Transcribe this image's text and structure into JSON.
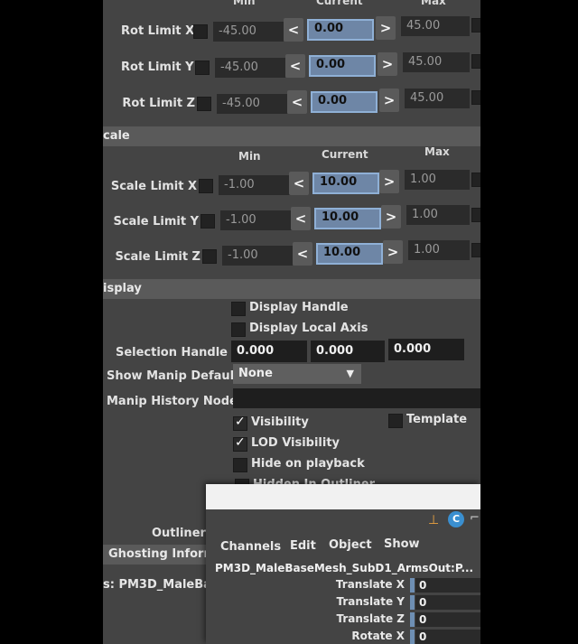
{
  "rot_limits": {
    "headers": {
      "min": "Min",
      "current": "Current",
      "max": "Max"
    },
    "rows": [
      {
        "label": "Rot Limit X",
        "min": "-45.00",
        "current": "0.00",
        "max": "45.00"
      },
      {
        "label": "Rot Limit Y",
        "min": "-45.00",
        "current": "0.00",
        "max": "45.00"
      },
      {
        "label": "Rot Limit Z",
        "min": "-45.00",
        "current": "0.00",
        "max": "45.00"
      }
    ]
  },
  "scale_section": {
    "title": "cale",
    "headers": {
      "min": "Min",
      "current": "Current",
      "max": "Max"
    },
    "rows": [
      {
        "label": "Scale Limit X",
        "min": "-1.00",
        "current": "10.00",
        "max": "1.00"
      },
      {
        "label": "Scale Limit Y",
        "min": "-1.00",
        "current": "10.00",
        "max": "1.00"
      },
      {
        "label": "Scale Limit Z",
        "min": "-1.00",
        "current": "10.00",
        "max": "1.00"
      }
    ]
  },
  "arrows": {
    "left": "<",
    "right": ">"
  },
  "display_section": {
    "title": "isplay",
    "display_handle": "Display Handle",
    "display_local_axis": "Display Local Axis",
    "selection_handle_label": "Selection Handle",
    "selection_handle_values": [
      "0.000",
      "0.000",
      "0.000"
    ],
    "show_manip_label": "Show Manip Default",
    "show_manip_value": "None",
    "manip_history_label": "Manip History Node",
    "manip_history_value": "",
    "visibility": "Visibility",
    "template": "Template",
    "lod_visibility": "LOD Visibility",
    "hide_on_playback": "Hide on playback",
    "hidden_in_outliner": "Hidden In Outliner",
    "outliner_label": "Outliner C",
    "ghosting_label": "Ghosting Inform"
  },
  "footer_label": "s:  PM3D_MaleBa",
  "channel_box": {
    "menu": [
      "Channels",
      "Edit",
      "Object",
      "Show"
    ],
    "node_name": "PM3D_MaleBaseMesh_SubD1_ArmsOut:P...",
    "channels": [
      {
        "label": "Translate X",
        "value": "0"
      },
      {
        "label": "Translate Y",
        "value": "0"
      },
      {
        "label": "Translate Z",
        "value": "0"
      },
      {
        "label": "Rotate X",
        "value": "0"
      }
    ]
  },
  "colors": {
    "panel": "#444444",
    "field_current": "#6e86a6",
    "section": "#5a5a5a"
  }
}
